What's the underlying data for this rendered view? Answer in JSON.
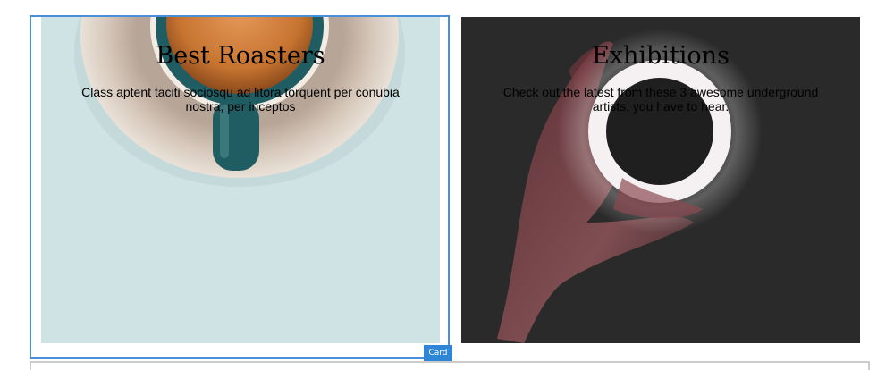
{
  "cards": [
    {
      "title": "Best Roasters",
      "text": "Class aptent taciti sociosqu ad litora torquent per conubia nostra, per inceptos",
      "image": "coffee-cup-image"
    },
    {
      "title": "Exhibitions",
      "text": "Check out the latest from these 3 awesome underground artists, you have to hear.",
      "image": "ring-light-hand-image"
    }
  ],
  "selection": {
    "tag_label": "Card",
    "outline_color": "#4a90d9"
  }
}
